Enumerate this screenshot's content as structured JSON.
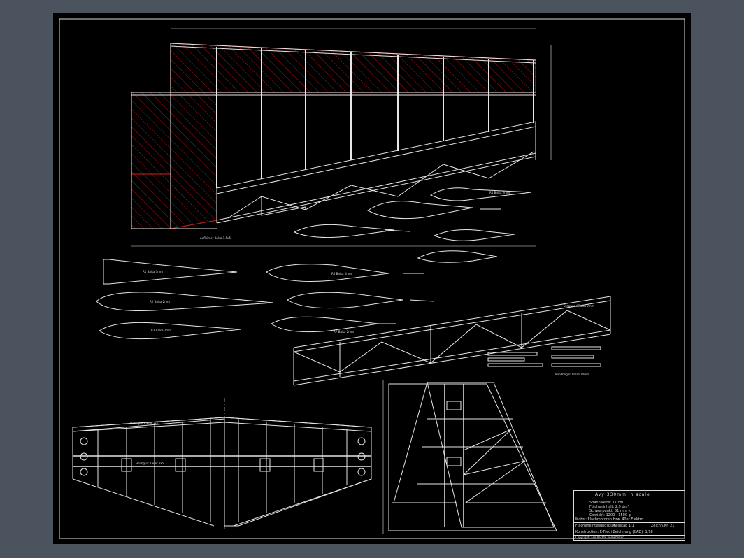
{
  "colors": {
    "background": "#4b535e",
    "sheet": "#000000",
    "line": "#e6e6e6",
    "hatch": "#d21e1e"
  },
  "title_block": {
    "heading": "Avy 330mm in scale",
    "spec_lines": [
      "Spannweite: 77 cm",
      "Flächeninhalt: 2,9 dm²",
      "Schwerpunkt: 51 mm v.",
      "Gewicht: 1200 - 1500 g",
      "Motor: Flachmotoren bzw. 40er Elektro"
    ],
    "row1": [
      "Flächeneinteilungsplan",
      "Maßstab 1:1",
      "Zeichn.Nr. 21"
    ],
    "row2": "Konstruktion: E-Fredi  Zeichnung (CAD): 1/98",
    "row3": "Copyright: alle Rechte vorbehalten"
  },
  "labels": {
    "rib_a": "R4 Balsa 2mm",
    "rib_b": "R1 Balsa 3mm",
    "rib_c": "R2 Balsa 2mm",
    "rib_d": "R3 Balsa 2mm",
    "rib_e": "R6 Balsa 2mm",
    "rib_f": "R7 Balsa 2mm",
    "spar_top": "Holmgurt Kiefer 3x5",
    "spar_bot": "Holmgurt Kiefer 3x5",
    "web": "Stegwand Balsa 2mm",
    "ail": "Randbogen Balsa 10mm",
    "note_red": "Aufleimer Balsa 1.5x5"
  }
}
